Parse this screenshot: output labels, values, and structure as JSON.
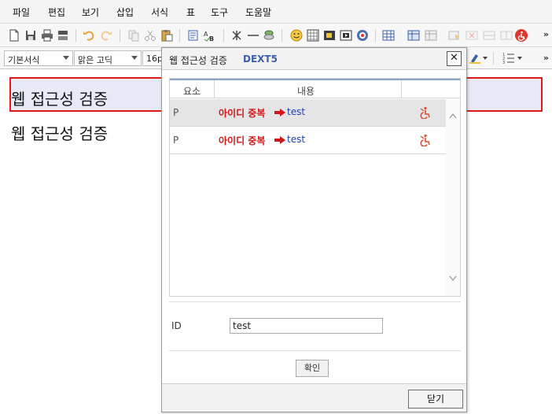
{
  "menu": {
    "items": [
      "파일",
      "편집",
      "보기",
      "삽입",
      "서식",
      "표",
      "도구",
      "도움말"
    ]
  },
  "toolbar": {
    "style_combo": "기본서식",
    "font_combo": "맑은 고딕",
    "size_combo": "16p",
    "more_label": "»",
    "colors": {
      "accent": "#3b5fa8",
      "alert": "#d41515",
      "link": "#1d3fb8",
      "highlight_border": "#e01a1a",
      "highlight_fill": "#e7eaf6"
    },
    "icons": [
      "new-doc-icon",
      "save-icon",
      "print-icon",
      "preview-icon",
      "undo-icon",
      "redo-icon",
      "copy-icon",
      "cut-icon",
      "paste-icon",
      "find-icon",
      "spellcheck-icon",
      "special-char-icon",
      "horizontal-line-icon",
      "image-stack-icon",
      "emoticon-icon",
      "pattern-icon",
      "image-icon",
      "media-icon",
      "flash-icon",
      "table-icon",
      "table-edit-icon",
      "form-icon",
      "accessibility-icon"
    ]
  },
  "editor": {
    "line1": "웹 접근성 검증",
    "line2": "웹 접근성 검증"
  },
  "dialog": {
    "title": "웹 접근성 검증",
    "brand": "DEXT5",
    "close_symbol": "✕",
    "columns": [
      "요소",
      "내용"
    ],
    "rows": [
      {
        "element": "P",
        "message": "아이디 중복",
        "value": "test",
        "icon": "accessibility-fix-icon"
      },
      {
        "element": "P",
        "message": "아이디 중복",
        "value": "test",
        "icon": "accessibility-fix-icon"
      }
    ],
    "id_label": "ID",
    "id_value": "test",
    "confirm_label": "확인",
    "close_label": "닫기"
  }
}
